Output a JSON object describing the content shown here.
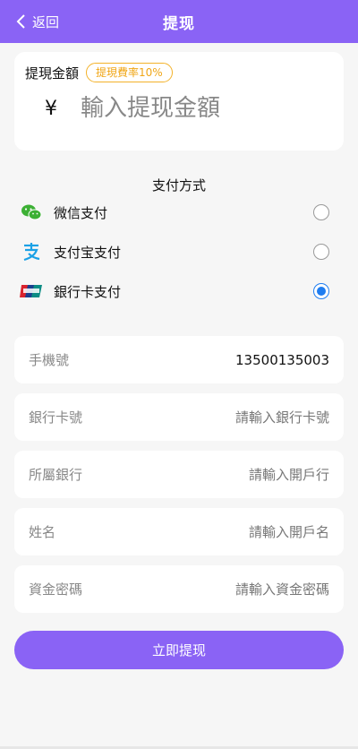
{
  "header": {
    "back_label": "返回",
    "title": "提现"
  },
  "amount": {
    "label": "提現金額",
    "fee_badge": "提現費率10%",
    "currency": "¥",
    "placeholder": "輸入提现金額"
  },
  "payment": {
    "title": "支付方式",
    "options": [
      {
        "label": "微信支付",
        "icon": "wechat-icon",
        "selected": false
      },
      {
        "label": "支付宝支付",
        "icon": "alipay-icon",
        "selected": false
      },
      {
        "label": "銀行卡支付",
        "icon": "unionpay-icon",
        "selected": true
      }
    ]
  },
  "form": {
    "phone": {
      "label": "手機號",
      "value": "13500135003"
    },
    "card_number": {
      "label": "銀行卡號",
      "placeholder": "請輸入銀行卡號"
    },
    "bank": {
      "label": "所屬銀行",
      "placeholder": "請輸入開戶行"
    },
    "name": {
      "label": "姓名",
      "placeholder": "請輸入開戶名"
    },
    "password": {
      "label": "資金密碼",
      "placeholder": "請輸入資金密碼"
    }
  },
  "submit_label": "立即提现",
  "colors": {
    "primary": "#8a63f5",
    "fee_badge": "#f0a616",
    "radio_selected": "#1f7df0",
    "wechat": "#3cb034",
    "alipay": "#1ba1e6"
  }
}
